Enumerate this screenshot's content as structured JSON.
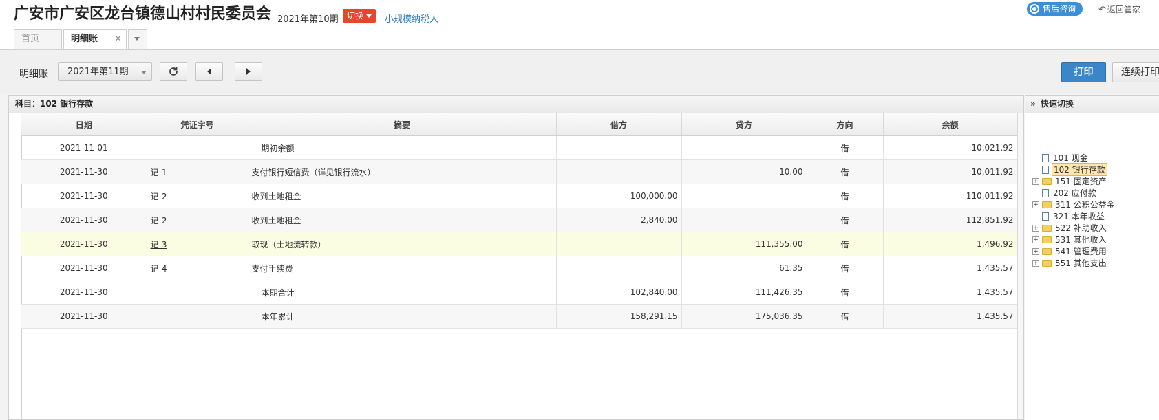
{
  "header": {
    "company": "广安市广安区龙台镇德山村村民委员会",
    "period": "2021年第10期",
    "switch_label": "切换",
    "taxpayer": "小规模纳税人",
    "support": "售后咨询",
    "back": "返回管家"
  },
  "tabs": [
    {
      "label": "首页"
    },
    {
      "label": "明细账",
      "active": true
    }
  ],
  "toolbar": {
    "label": "明细账",
    "period": "2021年第11期",
    "print": "打印",
    "continuous_print": "连续打印"
  },
  "ledger": {
    "subject": "科目：102  银行存款",
    "columns": [
      "日期",
      "凭证字号",
      "摘要",
      "借方",
      "贷方",
      "方向",
      "余额"
    ],
    "rows": [
      {
        "date": "2021-11-01",
        "voucher": "",
        "summary": "期初余额",
        "debit": "",
        "credit": "",
        "dir": "借",
        "balance": "10,021.92"
      },
      {
        "date": "2021-11-30",
        "voucher": "记-1",
        "summary": "支付银行短信费（详见银行流水）",
        "debit": "",
        "credit": "10.00",
        "dir": "借",
        "balance": "10,011.92"
      },
      {
        "date": "2021-11-30",
        "voucher": "记-2",
        "summary": "收到土地租金",
        "debit": "100,000.00",
        "credit": "",
        "dir": "借",
        "balance": "110,011.92"
      },
      {
        "date": "2021-11-30",
        "voucher": "记-2",
        "summary": "收到土地租金",
        "debit": "2,840.00",
        "credit": "",
        "dir": "借",
        "balance": "112,851.92"
      },
      {
        "date": "2021-11-30",
        "voucher": "记-3",
        "summary": "取现（土地流转款）",
        "debit": "",
        "credit": "111,355.00",
        "dir": "借",
        "balance": "1,496.92"
      },
      {
        "date": "2021-11-30",
        "voucher": "记-4",
        "summary": "支付手续费",
        "debit": "",
        "credit": "61.35",
        "dir": "借",
        "balance": "1,435.57"
      },
      {
        "date": "2021-11-30",
        "voucher": "",
        "summary": "本期合计",
        "debit": "102,840.00",
        "credit": "111,426.35",
        "dir": "借",
        "balance": "1,435.57"
      },
      {
        "date": "2021-11-30",
        "voucher": "",
        "summary": "本年累计",
        "debit": "158,291.15",
        "credit": "175,036.35",
        "dir": "借",
        "balance": "1,435.57"
      }
    ]
  },
  "quick_switch": {
    "title": "快速切换",
    "search_value": "",
    "items": [
      {
        "label": "101 现金",
        "icon": "document-icon",
        "expandable": false
      },
      {
        "label": "102 银行存款",
        "icon": "document-icon",
        "expandable": false,
        "selected": true
      },
      {
        "label": "151 固定资产",
        "icon": "folder-icon",
        "expandable": true
      },
      {
        "label": "202 应付款",
        "icon": "document-icon",
        "expandable": false
      },
      {
        "label": "311 公积公益金",
        "icon": "folder-icon",
        "expandable": true
      },
      {
        "label": "321 本年收益",
        "icon": "document-icon",
        "expandable": false
      },
      {
        "label": "522 补助收入",
        "icon": "folder-icon",
        "expandable": true
      },
      {
        "label": "531 其他收入",
        "icon": "folder-icon",
        "expandable": true
      },
      {
        "label": "541 管理费用",
        "icon": "folder-icon",
        "expandable": true
      },
      {
        "label": "551 其他支出",
        "icon": "folder-icon",
        "expandable": true
      }
    ]
  },
  "colors": {
    "accent": "#3a86c8",
    "switch": "#e8462b",
    "highlight_row": "#fbfde3",
    "selected_node": "#ffe6a9"
  }
}
